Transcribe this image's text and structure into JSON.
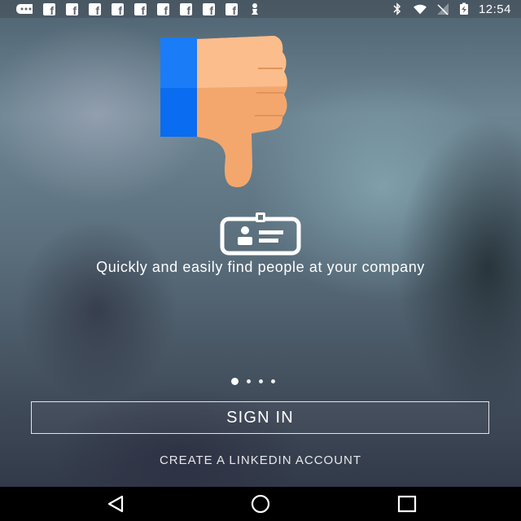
{
  "status_bar": {
    "left_icons": [
      "notification-chat-icon",
      "facebook-icon",
      "facebook-icon",
      "facebook-icon",
      "facebook-icon",
      "facebook-icon",
      "facebook-icon",
      "facebook-icon",
      "facebook-icon",
      "facebook-icon",
      "chess-pawn-icon"
    ],
    "right_icons": [
      "bluetooth-icon",
      "wifi-icon",
      "no-signal-icon",
      "battery-charging-icon"
    ],
    "time": "12:54"
  },
  "onboarding": {
    "hero_icon": "thumbs-down-icon",
    "feature_icon": "id-badge-icon",
    "tagline": "Quickly and easily find people at your company",
    "page_indicator": {
      "count": 4,
      "active_index": 0
    }
  },
  "actions": {
    "sign_in_label": "SIGN IN",
    "create_account_label": "CREATE A LINKEDIN ACCOUNT"
  },
  "nav_bar": {
    "buttons": [
      "back-icon",
      "home-icon",
      "recents-icon"
    ]
  },
  "colors": {
    "thumb_sleeve": "#0a6cf0",
    "thumb_skin_light": "#fbbd8c",
    "thumb_skin_dark": "#f4a76d"
  }
}
